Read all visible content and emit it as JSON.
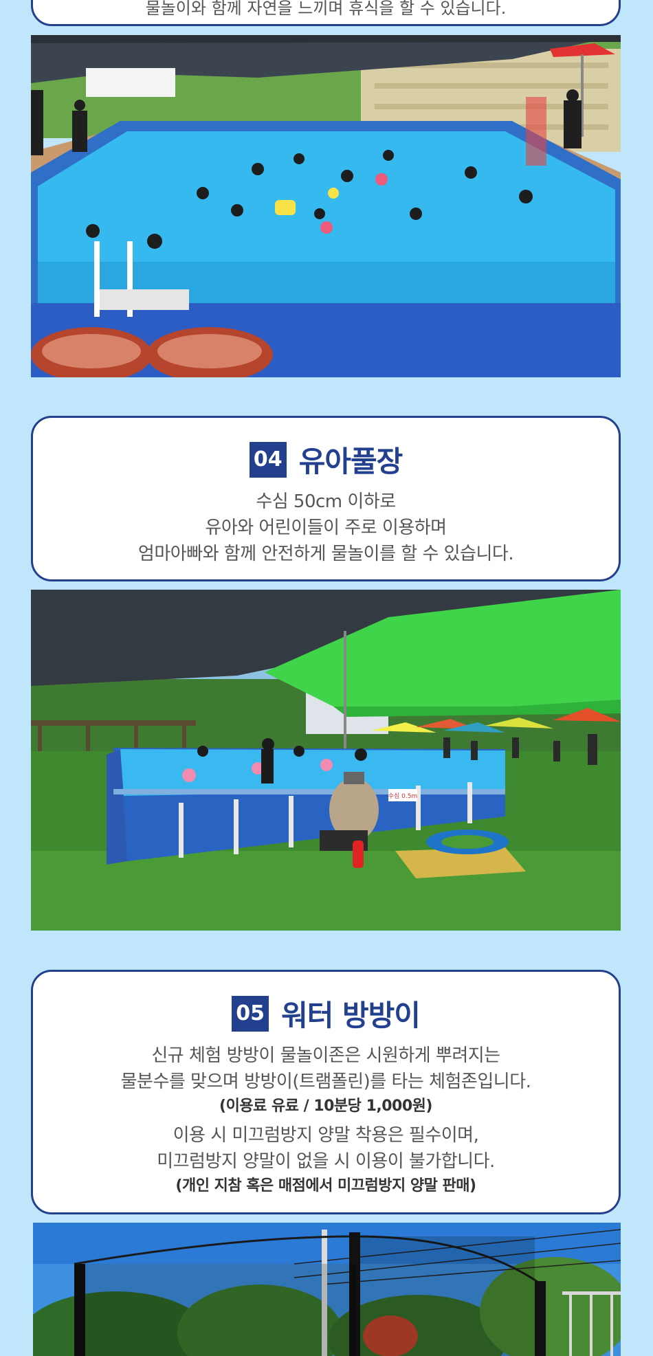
{
  "section03": {
    "partial_line": "물놀이와 함께 자연을 느끼며 휴식을 할 수 있습니다."
  },
  "section04": {
    "number": "04",
    "title": "유아풀장",
    "lines": [
      "수심 50cm 이하로",
      "유아와 어린이들이 주로 이용하며",
      "엄마아빠와 함께 안전하게 물놀이를 할 수 있습니다."
    ]
  },
  "section05": {
    "number": "05",
    "title": "워터 방방이",
    "lines": [
      "신규 체험 방방이 물놀이존은 시원하게 뿌려지는",
      "물분수를 맞으며 방방이(트램폴린)를 타는 체험존입니다."
    ],
    "fee_note": "(이용료 유료 / 10분당 1,000원)",
    "lines2": [
      "이용 시 미끄럼방지 양말 착용은 필수이며,",
      "미끄럼방지 양말이 없을 시 이용이 불가합니다."
    ],
    "sock_note": "(개인 지참 혹은 매점에서 미끄럼방지 양말 판매)"
  },
  "photos": {
    "pool_sign": "수심 0.5m"
  },
  "colors": {
    "background": "#bfe6fb",
    "accent": "#23408f",
    "pool_water": "#2fb3ec",
    "shade_green": "#3fd44a",
    "turf": "#3f8a2f"
  }
}
